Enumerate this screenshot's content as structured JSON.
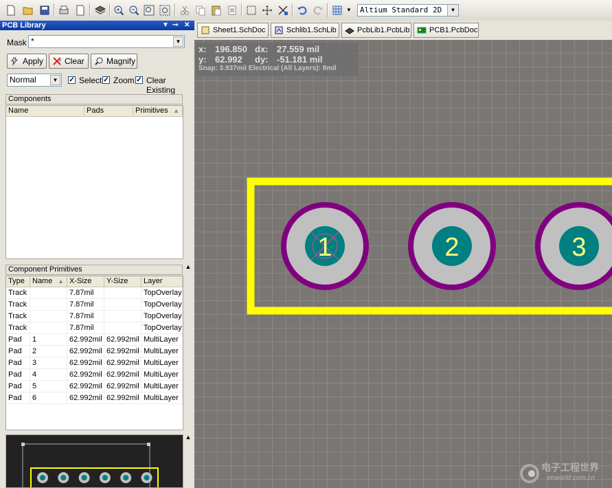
{
  "toolbar": {
    "view_mode": "Altium Standard 2D",
    "icons": [
      "new-file-icon",
      "open-folder-icon",
      "save-icon",
      "print-icon",
      "print-preview-icon",
      "layer-stack-icon",
      "zoom-in-icon",
      "zoom-out-icon",
      "zoom-fit-icon",
      "zoom-area-icon",
      "cut-icon",
      "copy-icon",
      "paste-icon",
      "rubber-stamp-icon",
      "select-rect-icon",
      "move-icon",
      "cross-select-icon",
      "undo-icon",
      "redo-icon",
      "grid-icon"
    ]
  },
  "panel": {
    "title": "PCB Library",
    "mask_label": "Mask",
    "mask_value": "*",
    "apply_label": "Apply",
    "clear_label": "Clear",
    "magnify_label": "Magnify",
    "mode_value": "Normal",
    "select_label": "Select",
    "zoom_label": "Zoom",
    "clear_existing_label": "Clear Existing",
    "components": {
      "title": "Components",
      "headers": [
        "Name",
        "Pads",
        "Primitives"
      ]
    },
    "primitives": {
      "title": "Component Primitives",
      "headers": [
        "Type",
        "Name",
        "X-Size",
        "Y-Size",
        "Layer"
      ],
      "rows": [
        [
          "Track",
          "",
          "7.87mil",
          "",
          "TopOverlay"
        ],
        [
          "Track",
          "",
          "7.87mil",
          "",
          "TopOverlay"
        ],
        [
          "Track",
          "",
          "7.87mil",
          "",
          "TopOverlay"
        ],
        [
          "Track",
          "",
          "7.87mil",
          "",
          "TopOverlay"
        ],
        [
          "Pad",
          "1",
          "62.992mil",
          "62.992mil",
          "MultiLayer"
        ],
        [
          "Pad",
          "2",
          "62.992mil",
          "62.992mil",
          "MultiLayer"
        ],
        [
          "Pad",
          "3",
          "62.992mil",
          "62.992mil",
          "MultiLayer"
        ],
        [
          "Pad",
          "4",
          "62.992mil",
          "62.992mil",
          "MultiLayer"
        ],
        [
          "Pad",
          "5",
          "62.992mil",
          "62.992mil",
          "MultiLayer"
        ],
        [
          "Pad",
          "6",
          "62.992mil",
          "62.992mil",
          "MultiLayer"
        ]
      ]
    }
  },
  "tabs": [
    {
      "label": "Sheet1.SchDoc"
    },
    {
      "label": "Schlib1.SchLib"
    },
    {
      "label": "PcbLib1.PcbLib"
    },
    {
      "label": "PCB1.PcbDoc"
    }
  ],
  "coords": {
    "x_label": "x:",
    "x_value": "196.850",
    "dx_label": "dx:",
    "dx_value": "27.559 mil",
    "y_label": "y:",
    "y_value": "62.992",
    "dy_label": "dy:",
    "dy_value": "-51.181 mil",
    "snap": "Snap: 3.937mil Electrical (All Layers): 8mil"
  },
  "pads": [
    {
      "label": "1"
    },
    {
      "label": "2"
    },
    {
      "label": "3"
    }
  ],
  "colors": {
    "overlay": "#ffff00",
    "pad_ring": "#800080",
    "pad_body": "#c0c0c0",
    "pad_hole": "#008080",
    "pad_label": "#ffff80",
    "grid_bg": "#7a7673"
  },
  "watermark": {
    "text": "电子工程世界",
    "url": "eeworld.com.cn"
  }
}
